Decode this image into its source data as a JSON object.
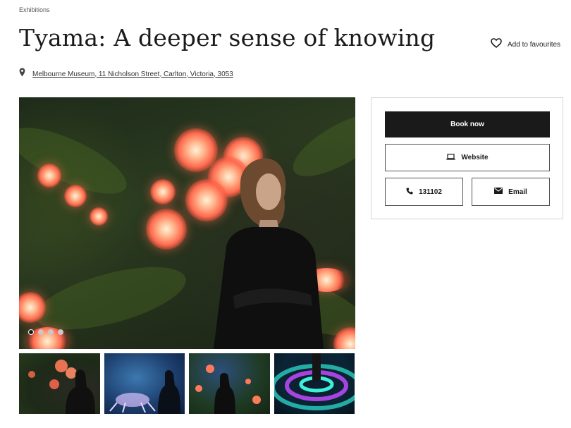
{
  "breadcrumb": "Exhibitions",
  "page_title": "Tyama: A deeper sense of knowing",
  "favourite_label": "Add to favourites",
  "address": "Melbourne Museum, 11 Nicholson Street, Carlton, Victoria, 3053",
  "carousel": {
    "slides": 4,
    "active_index": 0
  },
  "actions": {
    "book_label": "Book now",
    "website_label": "Website",
    "phone_label": "131102",
    "email_label": "Email"
  },
  "icons": {
    "favourite": "heart-icon",
    "address": "map-pin-icon",
    "website": "laptop-icon",
    "phone": "phone-icon",
    "email": "envelope-icon"
  },
  "colors": {
    "primary_button": "#1a1a1a",
    "text": "#1a1a1a",
    "panel_border": "#d6d6d6"
  }
}
